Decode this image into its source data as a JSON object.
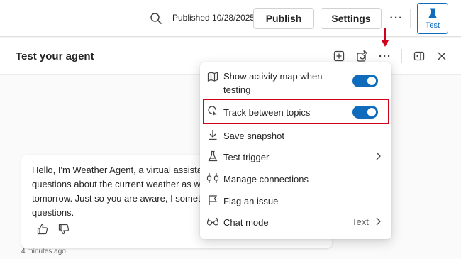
{
  "topbar": {
    "published_text": "Published 10/28/2025",
    "publish_label": "Publish",
    "settings_label": "Settings",
    "more_label": "···",
    "test_label": "Test"
  },
  "panel": {
    "title": "Test your agent",
    "more_label": "···"
  },
  "menu": {
    "items": [
      {
        "label_line1": "Show activity map when",
        "label_line2": "testing",
        "control": "toggle",
        "toggle_on": true,
        "icon": "map-icon"
      },
      {
        "label": "Track between topics",
        "control": "toggle",
        "toggle_on": true,
        "icon": "track-cursor-icon"
      },
      {
        "label": "Save snapshot",
        "icon": "download-icon"
      },
      {
        "label": "Test trigger",
        "control": "chevron",
        "icon": "beaker-icon"
      },
      {
        "label": "Manage connections",
        "icon": "plug-icon"
      },
      {
        "label": "Flag an issue",
        "icon": "flag-icon"
      },
      {
        "label": "Chat mode",
        "value": "Text",
        "control": "chevron",
        "icon": "glasses-icon"
      }
    ]
  },
  "chat": {
    "message_lines": [
      "Hello, I'm Weather Agent, a virtual assistant. Just so you know, I can answer",
      "questions about the current weather as well as the forecast for today and",
      "tomorrow. Just so you are aware, I sometimes use AI to answer your",
      "questions."
    ],
    "timestamp": "4 minutes ago"
  },
  "colors": {
    "accent": "#0f6cbd",
    "highlight_red": "#d0021b",
    "panel_bg": "#fafafa"
  }
}
